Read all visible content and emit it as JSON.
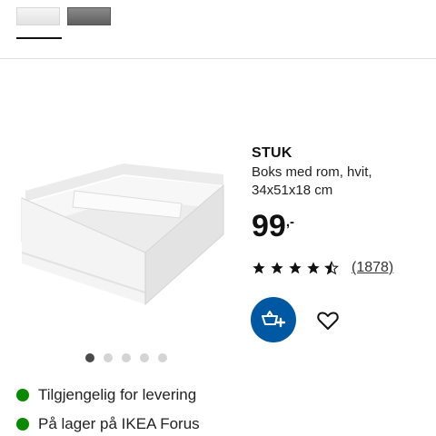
{
  "variants": [
    {
      "name": "white",
      "selected": true
    },
    {
      "name": "grey",
      "selected": false
    }
  ],
  "product": {
    "name": "STUK",
    "description": "Boks med rom, hvit, 34x51x18 cm",
    "price_integer": "99",
    "price_decimal": ",-",
    "rating": 4.5,
    "review_count": "(1878)"
  },
  "carousel": {
    "dots": 5,
    "active_index": 0
  },
  "availability": [
    {
      "text": "Tilgjengelig for levering",
      "status_color": "#0a8a00"
    },
    {
      "text": "På lager på IKEA Forus",
      "status_color": "#0a8a00"
    }
  ],
  "colors": {
    "accent": "#0058a3"
  },
  "icons": {
    "cart": "add-to-cart-icon",
    "favourite": "heart-icon"
  }
}
